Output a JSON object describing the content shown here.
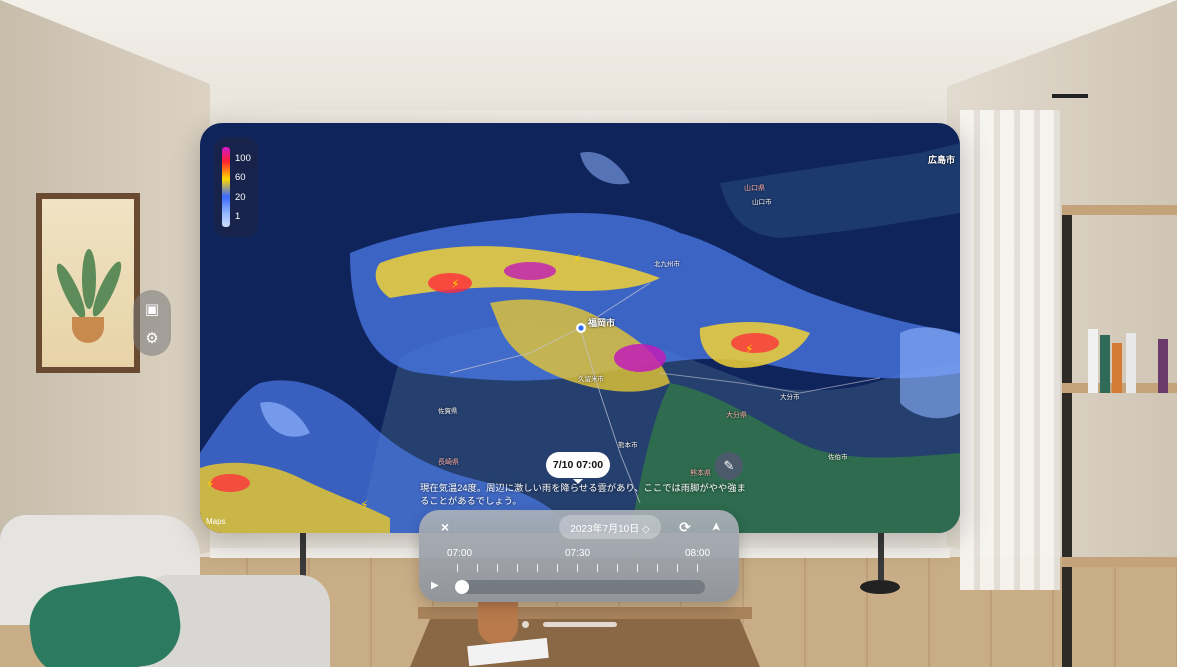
{
  "legend": {
    "levels": [
      "100",
      "60",
      "20",
      "1"
    ]
  },
  "map": {
    "selected_time": "7/10 07:00",
    "forecast_text": "現在気温24度。周辺に激しい雨を降らせる雲があり、ここでは雨脚がやや強まることがあるでしょう。",
    "attribution": "Maps",
    "cities": {
      "hiroshima": "広島市",
      "yamaguchi_pref": "山口県",
      "yamaguchi": "山口市",
      "kitakyushu": "北九州市",
      "fukuoka": "福岡市",
      "oita_city": "大分市",
      "oita_pref": "大分県",
      "kurume": "久留米市",
      "saga": "佐賀県",
      "nagasaki": "長崎県",
      "kumamoto": "熊本市",
      "kumamoto_pref": "熊本県",
      "saiki": "佐伯市"
    }
  },
  "controls": {
    "close_icon": "×",
    "date_label": "2023年7月10日 ◇",
    "refresh_icon": "⟳",
    "location_icon": "➤",
    "play_icon": "▶",
    "time_start": "07:00",
    "time_mid": "07:30",
    "time_end": "08:00",
    "playback_position": 0.0
  },
  "side_ornament": {
    "top_icon": "calendar-icon",
    "bottom_icon": "gear-icon"
  },
  "colors": {
    "map_bg": "#10245c",
    "rain_light": "#8fb4ff",
    "rain_mid": "#ffd800",
    "rain_heavy": "#d018d0"
  }
}
